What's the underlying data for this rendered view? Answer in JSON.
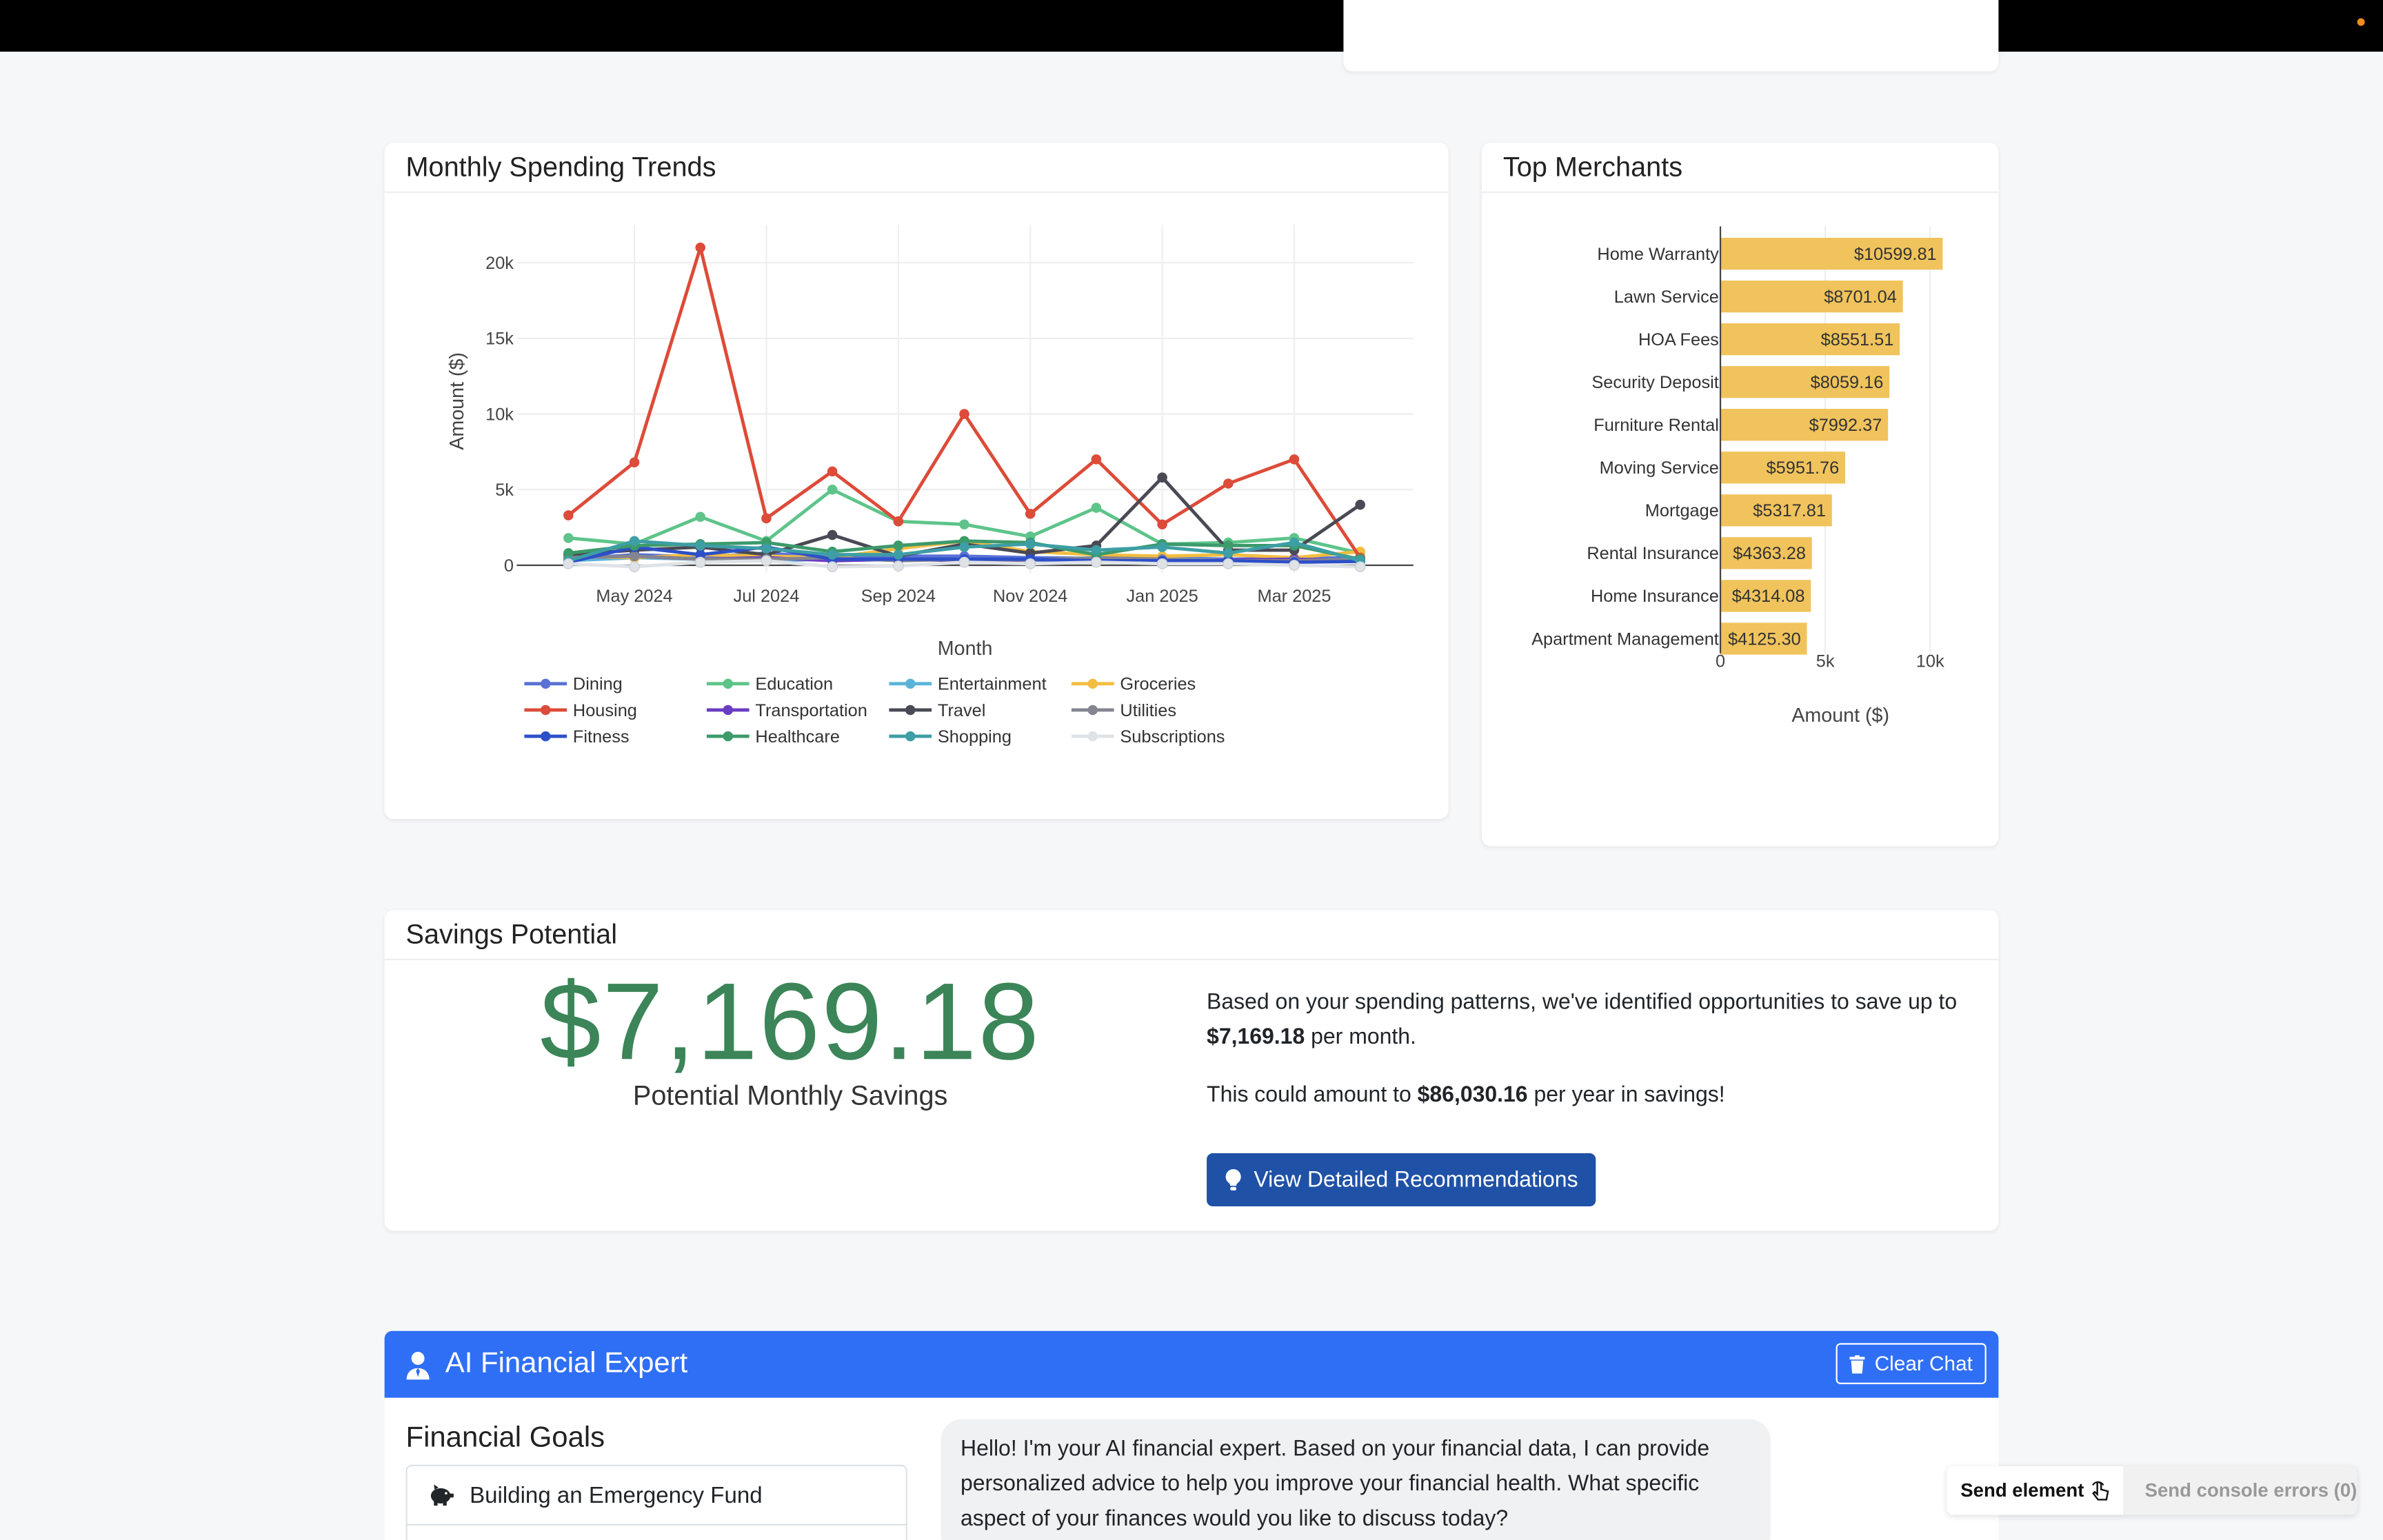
{
  "monthly_chart": {
    "title": "Monthly Spending Trends",
    "chart_data": {
      "type": "line",
      "xlabel": "Month",
      "ylabel": "Amount ($)",
      "x": [
        "2024-04",
        "2024-05",
        "2024-06",
        "2024-07",
        "2024-08",
        "2024-09",
        "2024-10",
        "2024-11",
        "2024-12",
        "2025-01",
        "2025-02",
        "2025-03",
        "2025-04"
      ],
      "x_ticks": [
        {
          "label": "May 2024",
          "month": "2024-05"
        },
        {
          "label": "Jul 2024",
          "month": "2024-07"
        },
        {
          "label": "Sep 2024",
          "month": "2024-09"
        },
        {
          "label": "Nov 2024",
          "month": "2024-11"
        },
        {
          "label": "Jan 2025",
          "month": "2025-01"
        },
        {
          "label": "Mar 2025",
          "month": "2025-03"
        }
      ],
      "y_ticks": [
        {
          "v": 0,
          "label": "0"
        },
        {
          "v": 5000,
          "label": "5k"
        },
        {
          "v": 10000,
          "label": "10k"
        },
        {
          "v": 15000,
          "label": "15k"
        },
        {
          "v": 20000,
          "label": "20k"
        }
      ],
      "ylim": [
        -500,
        22500
      ],
      "grid": true,
      "legend_position": "bottom",
      "series": [
        {
          "name": "Dining",
          "color": "#5a72d6",
          "values": [
            400,
            700,
            550,
            800,
            500,
            600,
            600,
            500,
            450,
            500,
            400,
            450,
            500
          ]
        },
        {
          "name": "Education",
          "color": "#5ec48a",
          "values": [
            1800,
            1400,
            3200,
            1600,
            5000,
            2900,
            2700,
            1900,
            3800,
            1400,
            1500,
            1800,
            800
          ]
        },
        {
          "name": "Entertainment",
          "color": "#5ab4d8",
          "values": [
            300,
            500,
            400,
            300,
            400,
            350,
            400,
            350,
            300,
            400,
            350,
            300,
            350
          ]
        },
        {
          "name": "Groceries",
          "color": "#f2bd42",
          "values": [
            600,
            500,
            700,
            600,
            500,
            1100,
            1600,
            900,
            700,
            600,
            700,
            500,
            900
          ]
        },
        {
          "name": "Housing",
          "color": "#dd4b39",
          "values": [
            3300,
            6800,
            21000,
            3100,
            6200,
            2900,
            10000,
            3400,
            7000,
            2700,
            5400,
            7000,
            500
          ]
        },
        {
          "name": "Transportation",
          "color": "#6a3dc2",
          "values": [
            500,
            600,
            400,
            500,
            300,
            400,
            300,
            350,
            400,
            300,
            350,
            400,
            300
          ]
        },
        {
          "name": "Travel",
          "color": "#4a4a55",
          "values": [
            700,
            1000,
            1200,
            700,
            2000,
            600,
            1400,
            800,
            1300,
            5800,
            1000,
            1000,
            4000
          ]
        },
        {
          "name": "Utilities",
          "color": "#858591",
          "values": [
            500,
            600,
            400,
            400,
            500,
            300,
            400,
            350,
            500,
            400,
            300,
            300,
            400
          ]
        },
        {
          "name": "Fitness",
          "color": "#2d4fc8",
          "values": [
            200,
            1200,
            700,
            1200,
            400,
            400,
            400,
            400,
            300,
            300,
            300,
            200,
            250
          ]
        },
        {
          "name": "Healthcare",
          "color": "#3c9a6b",
          "values": [
            800,
            1300,
            1400,
            1500,
            900,
            1300,
            1600,
            1500,
            700,
            1400,
            1300,
            1300,
            400
          ]
        },
        {
          "name": "Shopping",
          "color": "#3d9ea5",
          "values": [
            300,
            1600,
            1300,
            1100,
            700,
            700,
            1200,
            1400,
            1000,
            1200,
            800,
            1500,
            300
          ]
        },
        {
          "name": "Subscriptions",
          "color": "#dfe3e8",
          "values": [
            100,
            -100,
            200,
            300,
            -100,
            -50,
            200,
            100,
            200,
            100,
            100,
            0,
            -100
          ]
        }
      ]
    }
  },
  "merchants_chart": {
    "title": "Top Merchants",
    "chart_data": {
      "type": "bar",
      "orientation": "horizontal",
      "xlabel": "Amount ($)",
      "xlim": [
        0,
        11000
      ],
      "x_ticks": [
        {
          "v": 0,
          "label": "0"
        },
        {
          "v": 5000,
          "label": "5k"
        },
        {
          "v": 10000,
          "label": "10k"
        }
      ],
      "bar_color": "#f0c35c",
      "categories": [
        "Home Warranty",
        "Lawn Service",
        "HOA Fees",
        "Security Deposit",
        "Furniture Rental",
        "Moving Service",
        "Mortgage",
        "Rental Insurance",
        "Home Insurance",
        "Apartment Management"
      ],
      "values": [
        10599.81,
        8701.04,
        8551.51,
        8059.16,
        7992.37,
        5951.76,
        5317.81,
        4363.28,
        4314.08,
        4125.3
      ],
      "value_labels": [
        "$10599.81",
        "$8701.04",
        "$8551.51",
        "$8059.16",
        "$7992.37",
        "$5951.76",
        "$5317.81",
        "$4363.28",
        "$4314.08",
        "$4125.30"
      ]
    }
  },
  "savings": {
    "title": "Savings Potential",
    "amount": "$7,169.18",
    "amount_label": "Potential Monthly Savings",
    "text1_pre": "Based on your spending patterns, we've identified opportunities to save up to ",
    "text1_amount": "$7,169.18",
    "text1_post": " per month.",
    "text2_pre": "This could amount to ",
    "text2_amount": "$86,030.16",
    "text2_post": " per year in savings!",
    "button_label": "View Detailed Recommendations",
    "button_icon": "lightbulb-icon"
  },
  "ai_expert": {
    "title": "AI Financial Expert",
    "header_icon": "user-tie-icon",
    "clear_label": "Clear Chat",
    "clear_icon": "trash-icon",
    "goals_title": "Financial Goals",
    "goals": [
      {
        "label": "Building an Emergency Fund",
        "icon": "piggy-bank-icon"
      }
    ],
    "message": "Hello! I'm your AI financial expert. Based on your financial data, I can provide personalized advice to help you improve your financial health. What specific aspect of your finances would you like to discuss today?"
  },
  "devtools": {
    "send_element": "Send element",
    "send_errors": "Send console errors (0)"
  }
}
